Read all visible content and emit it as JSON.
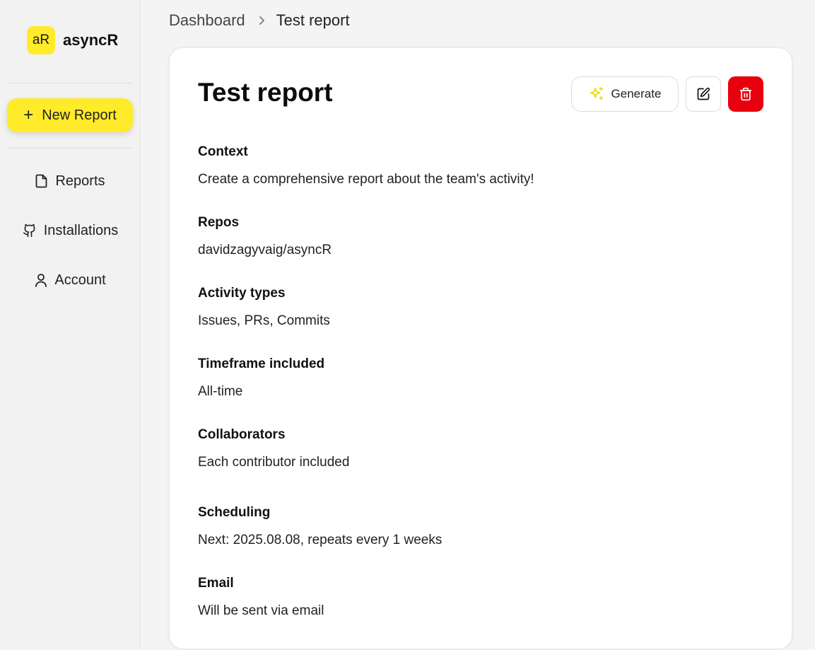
{
  "sidebar": {
    "logo_text": "aR",
    "app_name": "asyncR",
    "new_report_label": "New Report",
    "items": [
      {
        "label": "Reports",
        "icon": "file-icon"
      },
      {
        "label": "Installations",
        "icon": "github-icon"
      },
      {
        "label": "Account",
        "icon": "user-icon"
      }
    ]
  },
  "breadcrumb": {
    "parent": "Dashboard",
    "current": "Test report"
  },
  "report": {
    "title": "Test report",
    "generate_label": "Generate",
    "fields": [
      {
        "label": "Context",
        "value": "Create a comprehensive report about the team's activity!"
      },
      {
        "label": "Repos",
        "value": "davidzagyvaig/asyncR"
      },
      {
        "label": "Activity types",
        "value": "Issues, PRs, Commits"
      },
      {
        "label": "Timeframe included",
        "value": "All-time"
      },
      {
        "label": "Collaborators",
        "value": "Each contributor included"
      },
      {
        "label": "Scheduling",
        "value": "Next: 2025.08.08, repeats every 1 weeks"
      },
      {
        "label": "Email",
        "value": "Will be sent via email"
      }
    ]
  },
  "colors": {
    "accent": "#ffeb2a",
    "danger": "#e8000e"
  }
}
